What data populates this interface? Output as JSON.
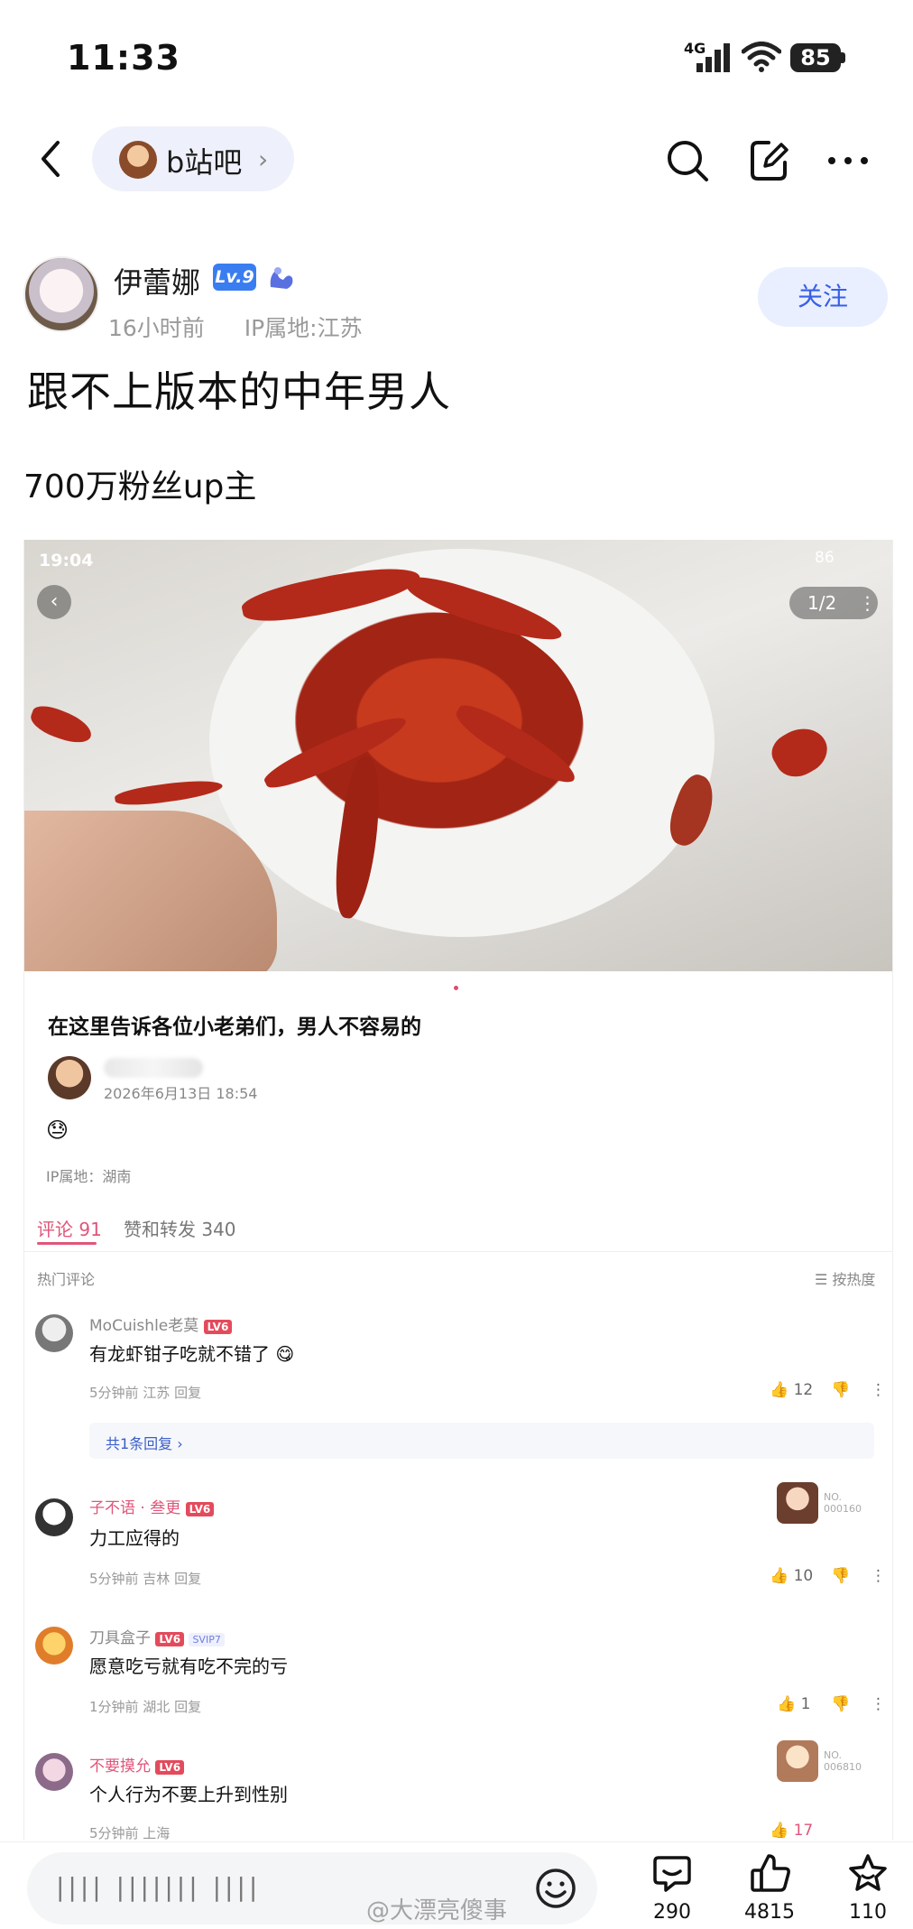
{
  "status_bar": {
    "time": "11:33",
    "network": "4G",
    "battery": "85"
  },
  "nav": {
    "forum_name": "b站吧"
  },
  "post": {
    "author_name": "伊蕾娜",
    "author_level": "Lv.9",
    "time_ago": "16小时前",
    "ip_location": "IP属地:江苏",
    "follow_label": "关注",
    "title": "跟不上版本的中年男人",
    "body": "700万粉丝up主"
  },
  "embedded": {
    "status_time": "19:04",
    "status_battery": "86",
    "page_indicator": "1/2",
    "title": "在这里告诉各位小老弟们，男人不容易的",
    "date": "2026年6月13日 18:54",
    "emoji": "😓",
    "ip": "IP属地：湖南",
    "tab_comments": "评论 91",
    "tab_likes": "赞和转发 340",
    "hot_comments_label": "热门评论",
    "sort_label": "☰ 按热度",
    "comments": [
      {
        "name": "MoCuishle老莫",
        "level": "LV6",
        "text": "有龙虾钳子吃就不错了",
        "meta": "5分钟前 江苏  回复",
        "likes": "12"
      },
      {
        "name": "子不语 · 叁更",
        "level": "LV6",
        "text": "力工应得的",
        "meta": "5分钟前 吉林  回复",
        "likes": "10",
        "sticker_code": "NO.\n000160"
      },
      {
        "name": "刀具盒子",
        "level": "LV6",
        "extra_badge": "SVIP7",
        "text": "愿意吃亏就有吃不完的亏",
        "meta": "1分钟前 湖北  回复",
        "likes": "1"
      },
      {
        "name": "不要摸允",
        "level": "LV6",
        "text": "个人行为不要上升到性别",
        "meta": "5分钟前 上海",
        "likes": "17",
        "sticker_code": "NO.\n006810"
      }
    ],
    "reply_link": "共1条回复 ›"
  },
  "bottom_bar": {
    "input_placeholder": "|||| ||||||| ||||",
    "watermark": "@大漂亮傻事",
    "comment_count": "290",
    "like_count": "4815",
    "favorite_count": "110"
  },
  "colors": {
    "accent_blue": "#3760e6",
    "level_blue": "#3a7df1",
    "pink": "#e0567a"
  }
}
